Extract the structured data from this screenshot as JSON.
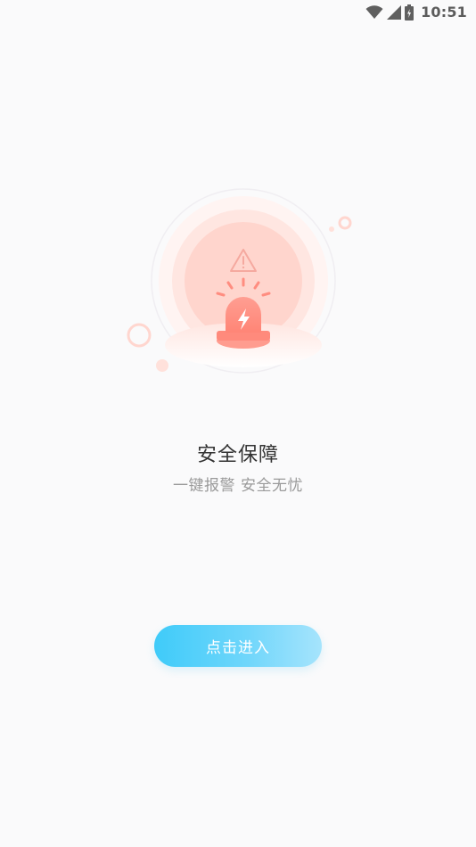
{
  "status_bar": {
    "time": "10:51",
    "icons": [
      "wifi-icon",
      "signal-icon",
      "battery-icon"
    ]
  },
  "illustration": {
    "icons": [
      "warning-icon",
      "alarm-siren-icon",
      "lightning-icon"
    ],
    "colors": {
      "siren": "#ff8d80",
      "halo": "#ffd9d2",
      "halo_inner": "#ffcfc6"
    }
  },
  "content": {
    "title": "安全保障",
    "subtitle": "一键报警 安全无忧"
  },
  "enter_button": {
    "label": "点击进入",
    "colors": {
      "start": "#3fcbf9",
      "end": "#a6e4fc"
    }
  }
}
